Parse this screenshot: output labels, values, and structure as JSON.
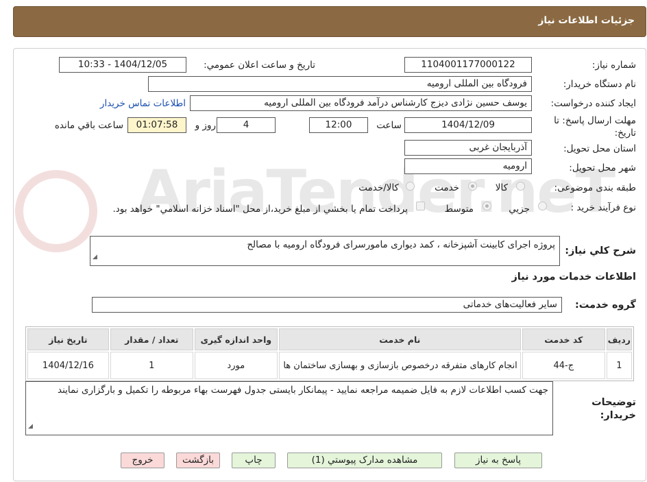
{
  "header": {
    "title": "جزئیات اطلاعات نیاز"
  },
  "form": {
    "need_number_label": "شماره نیاز:",
    "need_number": "1104001177000122",
    "announce_label": "تاريخ و ساعت اعلان عمومي:",
    "announce_value": "1404/12/05 - 10:33",
    "buyer_org_label": "نام دستگاه خريدار:",
    "buyer_org": "فرودگاه بین المللی ارومیه",
    "requester_label": "ايجاد کننده درخواست:",
    "requester": "یوسف حسین نژادی دیزج کارشناس درآمد فرودگاه بین المللی ارومیه",
    "buyer_contact_link": "اطلاعات تماس خريدار",
    "deadline_label": "مهلت ارسال پاسخ: تا تاريخ:",
    "deadline_date": "1404/12/09",
    "time_label": "ساعت",
    "deadline_time": "12:00",
    "days_value": "4",
    "days_label": "روز و",
    "remaining_time": "01:07:58",
    "remaining_label": "ساعت باقي مانده",
    "province_label": "استان محل تحويل:",
    "province": "آذربایجان غربی",
    "city_label": "شهر محل تحويل:",
    "city": "ارومیه",
    "category_label": "طبقه بندی موضوعی:",
    "category_options": [
      "کالا",
      "خدمت",
      "کالا/خدمت"
    ],
    "category_selected": "خدمت",
    "process_label": "نوع فرآيند خريد :",
    "process_options": [
      "جزيي",
      "متوسط"
    ],
    "process_selected": "متوسط",
    "payment_note": "پرداخت تمام يا بخشي از مبلغ خريد،از محل \"اسناد خزانه اسلامي\" خواهد بود."
  },
  "description": {
    "label": "شرح کلي نياز:",
    "text": "پروژه اجرای کابینت آشپزخانه ، کمد دیواری مامورسرای فرودگاه ارومیه با مصالح"
  },
  "services": {
    "section_title": "اطلاعات خدمات مورد نياز",
    "group_label": "گروه خدمت:",
    "group_value": "سایر فعالیت‌های خدماتی",
    "columns": [
      "رديف",
      "کد خدمت",
      "نام خدمت",
      "واحد اندازه گيری",
      "تعداد / مقدار",
      "تاريخ نياز"
    ],
    "rows": [
      {
        "index": "1",
        "code": "ج-44",
        "name": "انجام کارهای متفرقه درخصوص بازسازی و بهسازی ساختمان ها",
        "unit": "مورد",
        "qty": "1",
        "date": "1404/12/16"
      }
    ]
  },
  "buyer_notes": {
    "label": "توضيحات خريدار:",
    "text": "جهت کسب اطلاعات لازم به فایل ضمیمه مراجعه نمایید - پیمانکار بایستی جدول فهرست بهاء مربوطه را تکمیل و بارگزاری نمایند"
  },
  "buttons": {
    "reply": "پاسخ به نياز",
    "attachments": "مشاهده مدارک پيوستي (1)",
    "print": "چاپ",
    "back": "بازگشت",
    "exit": "خروج"
  },
  "watermark": "AriaTender.neT",
  "colors": {
    "header_bg": "#8b6a43",
    "link": "#1a4fb0",
    "highlight": "#fff5cc",
    "button_green": "#e4f5da",
    "button_pink": "#fbd9d9"
  }
}
